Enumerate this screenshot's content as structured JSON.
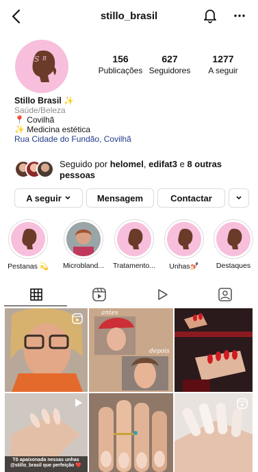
{
  "header": {
    "username": "stillo_brasil",
    "icons": {
      "back": "chevron-left-icon",
      "notifications": "bell-icon",
      "more": "ellipsis-icon"
    }
  },
  "profile": {
    "stats": [
      {
        "value": "156",
        "label": "Publicações"
      },
      {
        "value": "627",
        "label": "Seguidores"
      },
      {
        "value": "1277",
        "label": "A seguir"
      }
    ],
    "name": "Stillo Brasil",
    "name_emoji": "✨",
    "category": "Saúde/Beleza",
    "location": "Covilhã",
    "specialty": "Medicina estética",
    "address": "Rua Cidade do Fundão, Covilhã",
    "followed_by": {
      "prefix": "Seguido por ",
      "user1": "helomel",
      "sep": ", ",
      "user2": "edifat3",
      "middle": " e ",
      "others": "8 outras pessoas"
    }
  },
  "actions": {
    "following": "A seguir",
    "message": "Mensagem",
    "contact": "Contactar"
  },
  "highlights": [
    {
      "label": "Pestanas 💫"
    },
    {
      "label": "Microbland..."
    },
    {
      "label": "Tratamento..."
    },
    {
      "label": "Unhas💅🏻"
    },
    {
      "label": "Destaques"
    }
  ],
  "tabs": [
    {
      "name": "grid",
      "icon": "grid-icon"
    },
    {
      "name": "reels",
      "icon": "reels-icon"
    },
    {
      "name": "video",
      "icon": "play-icon"
    },
    {
      "name": "tagged",
      "icon": "tagged-icon"
    }
  ],
  "posts": [
    {
      "type": "reel",
      "text": ""
    },
    {
      "type": "image",
      "text_top": "antes",
      "text_bottom": "depois"
    },
    {
      "type": "image",
      "text": ""
    },
    {
      "type": "video",
      "caption": "Tô apaixonada nessas unhas @stillo_brasil que perfeição ❤️"
    },
    {
      "type": "image",
      "text": ""
    },
    {
      "type": "reel",
      "text": ""
    }
  ],
  "colors": {
    "brand_pink": "#f5b8d6",
    "brand_brown": "#6b3b2a",
    "border": "#dbdbdb",
    "link": "#1f3a8a"
  }
}
